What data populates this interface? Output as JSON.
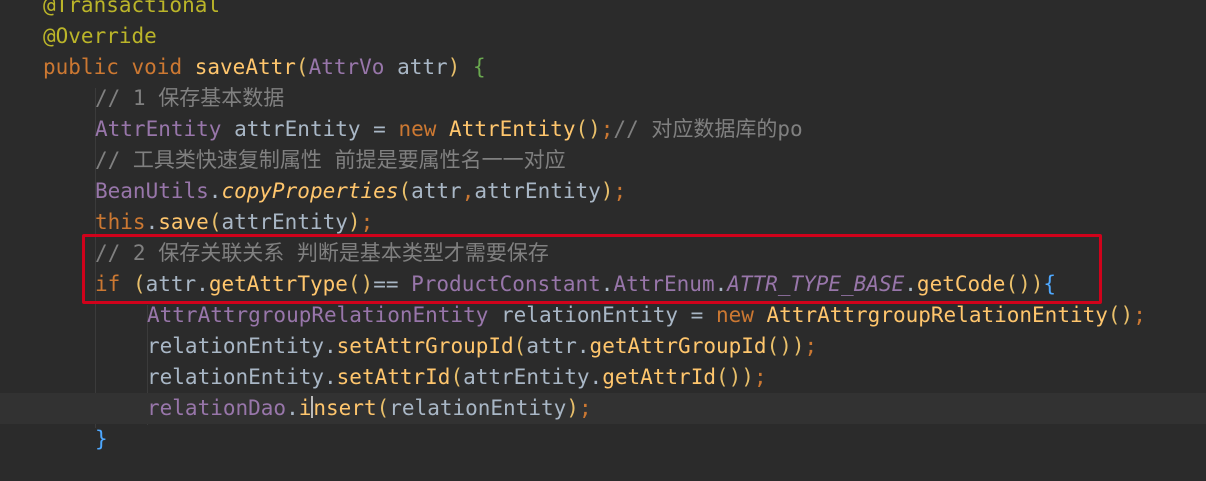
{
  "lines": {
    "l0": "@Transactional",
    "l1": "@Override",
    "l2": {
      "kw1": "public",
      "kw2": "void",
      "fn": "saveAttr",
      "open": "(",
      "type": "AttrVo",
      "arg": " attr",
      "close": ")",
      "brace": "{"
    },
    "l3": "// 1 保存基本数据",
    "l4": {
      "type": "AttrEntity",
      "var": " attrEntity = ",
      "kw": "new",
      "cls": " AttrEntity",
      "parens": "()",
      "semi": ";",
      "cmt": "// 对应数据库的po"
    },
    "l5": "// 工具类快速复制属性 前提是要属性名一一对应",
    "l6": {
      "cls": "BeanUtils",
      "dot": ".",
      "fn": "copyProperties",
      "open": "(",
      "a1": "attr",
      "comma": ",",
      "a2": "attrEntity",
      "close": ")",
      "semi": ";"
    },
    "l7": {
      "kw": "this",
      "dot": ".",
      "fn": "save",
      "open": "(",
      "arg": "attrEntity",
      "close": ")",
      "semi": ";"
    },
    "l8": "// 2 保存关联关系 判断是基本类型才需要保存",
    "l9": {
      "kw": "if",
      "open": " (",
      "var": "attr.",
      "fn": "getAttrType",
      "p1": "()",
      "op": "== ",
      "cls": "ProductConstant",
      "dot1": ".",
      "cls2": "AttrEnum",
      "dot2": ".",
      "const": "ATTR_TYPE_BASE",
      "dot3": ".",
      "fn2": "getCode",
      "p2": "()",
      "close": ")",
      "brace": "{"
    },
    "l10": {
      "type": "AttrAttrgroupRelationEntity",
      "var": " relationEntity = ",
      "kw": "new",
      "cls": " AttrAttrgroupRelationEntity",
      "parens": "()",
      "semi": ";"
    },
    "l11": {
      "var": "relationEntity.",
      "fn": "setAttrGroupId",
      "open": "(",
      "arg": "attr.",
      "fn2": "getAttrGroupId",
      "p": "()",
      "close": ")",
      "semi": ";"
    },
    "l12": {
      "var": "relationEntity.",
      "fn": "setAttrId",
      "open": "(",
      "arg": "attrEntity.",
      "fn2": "getAttrId",
      "p": "()",
      "close": ")",
      "semi": ";"
    },
    "l13": {
      "cls": "relationDao",
      "dot": ".",
      "fn_a": "i",
      "fn_b": "nsert",
      "open": "(",
      "arg": "relationEntity",
      "close": ")",
      "semi": ";"
    },
    "l14": "}"
  },
  "colors": {
    "background": "#2b2b2b",
    "keyword": "#cc7832",
    "method": "#ffc66d",
    "field": "#9876aa",
    "comment": "#808080",
    "annotation": "#bbb529",
    "highlight_box": "#d0021b"
  }
}
